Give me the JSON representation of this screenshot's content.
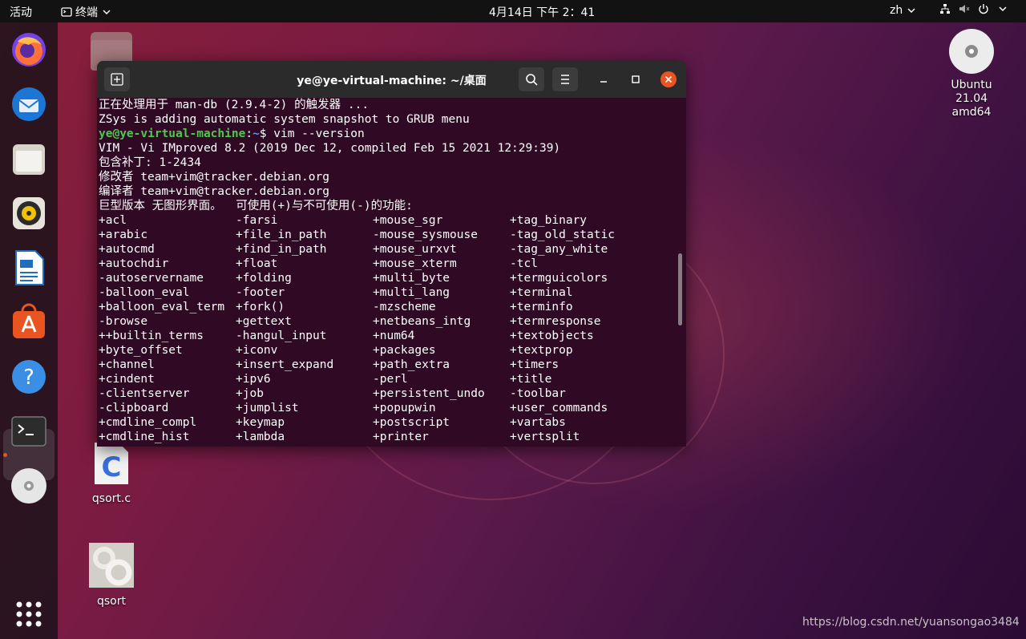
{
  "topbar": {
    "activities": "活动",
    "app_name": "终端",
    "clock": "4月14日  下午 2：41",
    "input_method": "zh"
  },
  "desktop": {
    "icons": [
      {
        "label": "Ubuntu 21.04\namd64",
        "icon": "disc-icon"
      },
      {
        "label": "qsort.c",
        "icon": "c-file-icon"
      },
      {
        "label": "qsort",
        "icon": "executable-gear-icon"
      }
    ],
    "watermark": "https://blog.csdn.net/yuansongao3484"
  },
  "dock": {
    "items": [
      {
        "name": "firefox",
        "icon": "firefox-icon"
      },
      {
        "name": "thunderbird",
        "icon": "thunderbird-icon"
      },
      {
        "name": "files",
        "icon": "files-icon"
      },
      {
        "name": "rhythmbox",
        "icon": "rhythmbox-icon"
      },
      {
        "name": "libreoffice-writer",
        "icon": "writer-icon"
      },
      {
        "name": "software",
        "icon": "software-icon"
      },
      {
        "name": "help",
        "icon": "help-icon"
      },
      {
        "name": "terminal",
        "icon": "terminal-icon"
      },
      {
        "name": "disc",
        "icon": "disc-icon"
      },
      {
        "name": "show-apps",
        "icon": "app-grid-icon"
      }
    ]
  },
  "terminal": {
    "title": "ye@ye-virtual-machine: ~/桌面",
    "lines": [
      "正在处理用于 man-db (2.9.4-2) 的触发器 ...",
      "ZSys is adding automatic system snapshot to GRUB menu"
    ],
    "prompt_user": "ye@ye-virtual-machine",
    "prompt_path": "~",
    "prompt_cmd": "$ vim --version",
    "version_lines": [
      "VIM - Vi IMproved 8.2 (2019 Dec 12, compiled Feb 15 2021 12:29:39)",
      "包含补丁: 1-2434",
      "修改者 team+vim@tracker.debian.org",
      "编译者 team+vim@tracker.debian.org",
      "巨型版本 无图形界面。  可使用(+)与不可使用(-)的功能:"
    ],
    "features": [
      [
        "+acl",
        "-farsi",
        "+mouse_sgr",
        "+tag_binary"
      ],
      [
        "+arabic",
        "+file_in_path",
        "-mouse_sysmouse",
        "-tag_old_static"
      ],
      [
        "+autocmd",
        "+find_in_path",
        "+mouse_urxvt",
        "-tag_any_white"
      ],
      [
        "+autochdir",
        "+float",
        "+mouse_xterm",
        "-tcl"
      ],
      [
        "-autoservername",
        "+folding",
        "+multi_byte",
        "+termguicolors"
      ],
      [
        "-balloon_eval",
        "-footer",
        "+multi_lang",
        "+terminal"
      ],
      [
        "+balloon_eval_term",
        "+fork()",
        "-mzscheme",
        "+terminfo"
      ],
      [
        "-browse",
        "+gettext",
        "+netbeans_intg",
        "+termresponse"
      ],
      [
        "++builtin_terms",
        "-hangul_input",
        "+num64",
        "+textobjects"
      ],
      [
        "+byte_offset",
        "+iconv",
        "+packages",
        "+textprop"
      ],
      [
        "+channel",
        "+insert_expand",
        "+path_extra",
        "+timers"
      ],
      [
        "+cindent",
        "+ipv6",
        "-perl",
        "+title"
      ],
      [
        "-clientserver",
        "+job",
        "+persistent_undo",
        "-toolbar"
      ],
      [
        "-clipboard",
        "+jumplist",
        "+popupwin",
        "+user_commands"
      ],
      [
        "+cmdline_compl",
        "+keymap",
        "+postscript",
        "+vartabs"
      ],
      [
        "+cmdline_hist",
        "+lambda",
        "+printer",
        "+vertsplit"
      ]
    ]
  }
}
